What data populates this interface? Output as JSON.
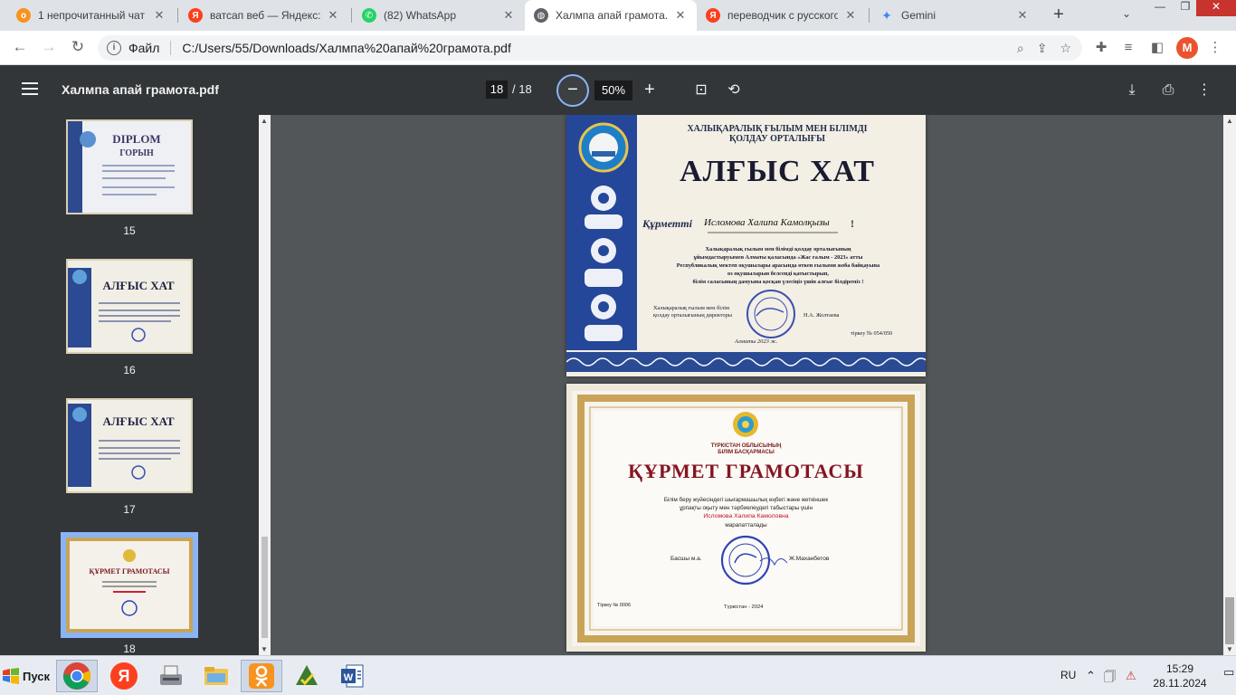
{
  "tabs": [
    {
      "label": "1 непрочитанный чат",
      "icon": "ok-icon",
      "color": "#f7931e",
      "glyph": "о"
    },
    {
      "label": "ватсап веб — Яндекс: на",
      "icon": "yandex-icon",
      "color": "#fc3f1d",
      "glyph": "Я"
    },
    {
      "label": "(82) WhatsApp",
      "icon": "whatsapp-icon",
      "color": "#25d366",
      "glyph": "✆"
    },
    {
      "label": "Халмпа апай грамота.pd",
      "icon": "globe-icon",
      "color": "#5f6368",
      "glyph": "◍"
    },
    {
      "label": "переводчик с русского н",
      "icon": "yandex-icon",
      "color": "#fc3f1d",
      "glyph": "Я"
    },
    {
      "label": "Gemini",
      "icon": "gemini-icon",
      "color": "#4285f4",
      "glyph": "✦"
    }
  ],
  "active_tab": 3,
  "address": {
    "scheme": "Файл",
    "url": "C:/Users/55/Downloads/Халмпа%20апай%20грамота.pdf"
  },
  "profile_initial": "M",
  "pdf": {
    "title": "Халмпа апай грамота.pdf",
    "page": "18",
    "total": "/ 18",
    "zoom": "50%"
  },
  "thumbnails": [
    {
      "label": "15",
      "kind": "DIPLOM",
      "line2": "ГОРЫН"
    },
    {
      "label": "16",
      "kind": "АЛҒЫС ХАТ",
      "line2": ""
    },
    {
      "label": "17",
      "kind": "АЛҒЫС ХАТ",
      "line2": ""
    },
    {
      "label": "18",
      "kind": "ҚҰРМЕТ ГРАМОТАСЫ",
      "line2": ""
    }
  ],
  "doc1": {
    "org": "ХАЛЫҚАРАЛЫҚ ҒЫЛЫМ МЕН БІЛІМДІ\nҚОЛДАУ ОРТАЛЫҒЫ",
    "title": "АЛҒЫС ХАТ",
    "salute": "Құрметті",
    "name": "Исломова Халипа Камолқызы",
    "excl": "!",
    "body": "Халықаралық ғылым мен білімді қолдау орталығының\nұйымдастыруымен Алматы қаласында «Жас ғалым - 2023» атты\nРеспубликалық мектеп оқушылары арасында өткен ғылыми жоба байқауына\nөз оқушыларын белсенді қатыстырып,\nбілім саласының дамуына қосқан үлесіңіз үшін алғыс білдіреміз !",
    "sign_left": "Халықаралық ғылым мен білім\nқолдау орталығының директоры",
    "signer": "Н.А. Жолтаева",
    "reg": "тіркеу № 054/050",
    "place": "Алматы 2023 ж."
  },
  "doc2": {
    "org": "ТҮРКІСТАН ОБЛЫСЫНЫҢ\nБІЛІМ БАСҚАРМАСЫ",
    "title": "ҚҰРМЕТ ГРАМОТАСЫ",
    "body": "Білім беру жүйесіндегі шығармашылық еңбегі және жеткіншек\nұрпақты оқыту мен тәрбиелеудегі табыстары үшін",
    "name": "Исломова Халипа Камоловна",
    "awarded": "марапатталады",
    "sign_left": "Басшы м.а.",
    "signer": "Ж.Маханбетов",
    "reg": "Тіркеу № 0006",
    "place": "Түркістан - 2024"
  },
  "taskbar": {
    "start": "Пуск",
    "lang": "RU",
    "time": "15:29",
    "date": "28.11.2024",
    "apps": [
      "chrome-icon",
      "yandex-browser-icon",
      "scanner-icon",
      "file-explorer-icon",
      "odnoklassniki-icon",
      "checklist-app-icon",
      "word-icon"
    ]
  }
}
